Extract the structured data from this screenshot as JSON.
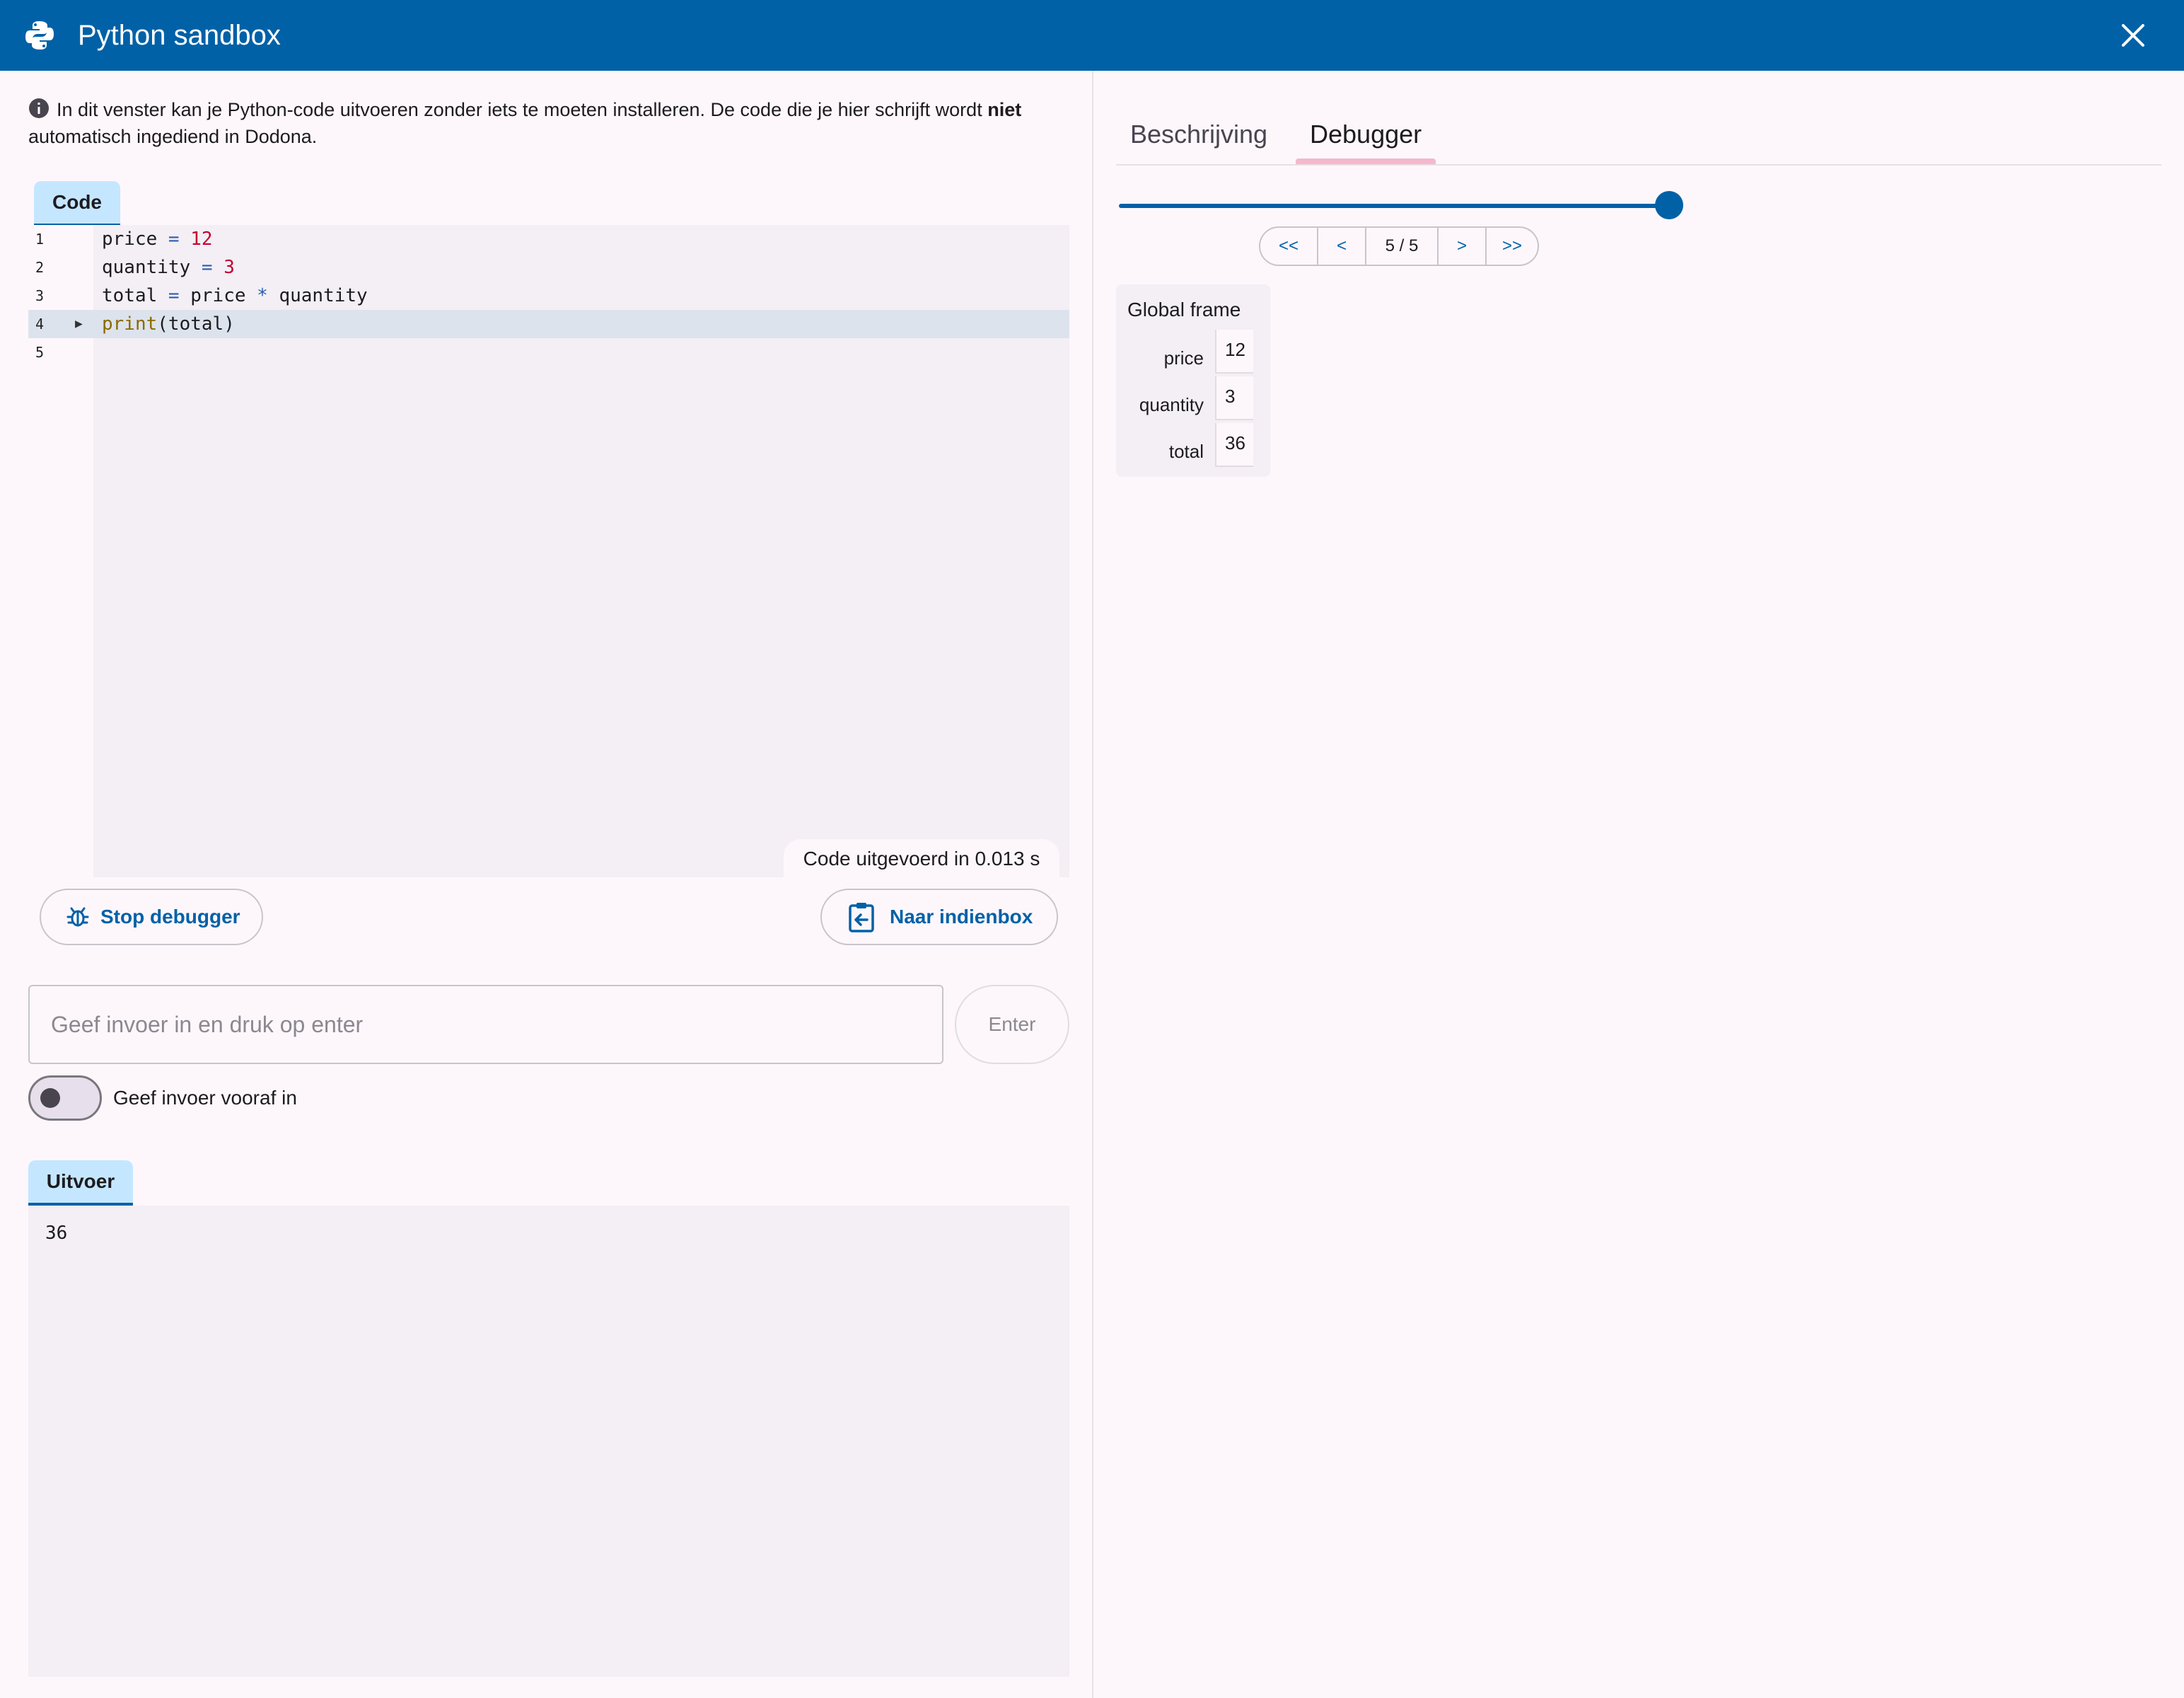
{
  "window": {
    "title": "Python sandbox"
  },
  "info": {
    "text_before": "In dit venster kan je Python-code uitvoeren zonder iets te moeten installeren. De code die je hier schrijft wordt ",
    "bold": "niet",
    "text_after": " automatisch ingediend in Dodona."
  },
  "editor": {
    "tab_label": "Code",
    "lines": [
      {
        "num": "1",
        "tokens": [
          {
            "t": "price ",
            "c": ""
          },
          {
            "t": "=",
            "c": "op"
          },
          {
            "t": " ",
            "c": ""
          },
          {
            "t": "12",
            "c": "num"
          }
        ]
      },
      {
        "num": "2",
        "tokens": [
          {
            "t": "quantity ",
            "c": ""
          },
          {
            "t": "=",
            "c": "op"
          },
          {
            "t": " ",
            "c": ""
          },
          {
            "t": "3",
            "c": "num"
          }
        ]
      },
      {
        "num": "3",
        "tokens": [
          {
            "t": "total ",
            "c": ""
          },
          {
            "t": "=",
            "c": "op"
          },
          {
            "t": " price ",
            "c": ""
          },
          {
            "t": "*",
            "c": "op"
          },
          {
            "t": " quantity",
            "c": ""
          }
        ]
      },
      {
        "num": "4",
        "tokens": [
          {
            "t": "print",
            "c": "fn"
          },
          {
            "t": "(total)",
            "c": ""
          }
        ],
        "active": true,
        "arrow": "▶"
      },
      {
        "num": "5",
        "tokens": []
      }
    ],
    "exec_time": "Code uitgevoerd in 0.013 s"
  },
  "buttons": {
    "stop_debugger": "Stop debugger",
    "to_submit": "Naar indienbox"
  },
  "stdin": {
    "placeholder": "Geef invoer in en druk op enter",
    "enter_label": "Enter"
  },
  "prefill_toggle": {
    "label": "Geef invoer vooraf in",
    "checked": false
  },
  "output": {
    "tab_label": "Uitvoer",
    "text": "36"
  },
  "right_tabs": {
    "description": "Beschrijving",
    "debugger": "Debugger",
    "active": "debugger"
  },
  "debugger": {
    "step_current": 5,
    "step_total": 5,
    "first_label": "<<",
    "prev_label": "<",
    "counter": "5 / 5",
    "next_label": ">",
    "last_label": ">>",
    "frame": {
      "title": "Global frame",
      "vars": [
        {
          "name": "price",
          "value": "12"
        },
        {
          "name": "quantity",
          "value": "3"
        },
        {
          "name": "total",
          "value": "36"
        }
      ]
    }
  },
  "colors": {
    "primary": "#0061a7",
    "tab_bg": "#c4e7ff",
    "indicator": "#f5b8cc",
    "surface": "#f3eff4"
  }
}
